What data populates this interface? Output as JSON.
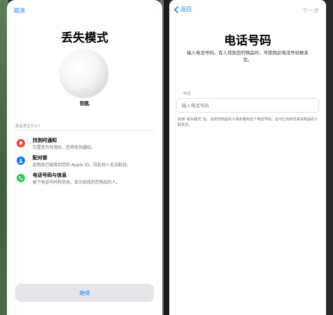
{
  "left": {
    "cancel_label": "取消",
    "title": "丢失模式",
    "item_name": "钥匙",
    "section_label": "将会发生什么?",
    "features": [
      {
        "title": "找到时通知",
        "desc": "位置变为可用时，您将收到通知。",
        "icon": "bell-icon",
        "color": "#ff3b30"
      },
      {
        "title": "配对锁",
        "desc": "此物品已链接到您的 Apple ID。因此他人无法配对。",
        "icon": "person-icon",
        "color": "#0a7aff"
      },
      {
        "title": "电话号码与信息",
        "desc": "留下电话号码和信息，显示给找到您物品的人。",
        "icon": "phone-icon",
        "color": "#34c759"
      }
    ],
    "continue_label": "继续"
  },
  "right": {
    "back_label": "返回",
    "next_label": "下一步",
    "title": "电话号码",
    "subtitle": "输入电话号码。有人找到您的物品时，可使用此电话号码联系您。",
    "field_label": "电话",
    "field_placeholder": "输入电话号码",
    "field_value": "",
    "note": "启用“丢失模式”后，找到您物品的人将会看到这个电话号码。这可让找到您丢失物品的人联系您。"
  },
  "colors": {
    "accent": "#0a7aff",
    "disabled": "#b3b3b8"
  }
}
